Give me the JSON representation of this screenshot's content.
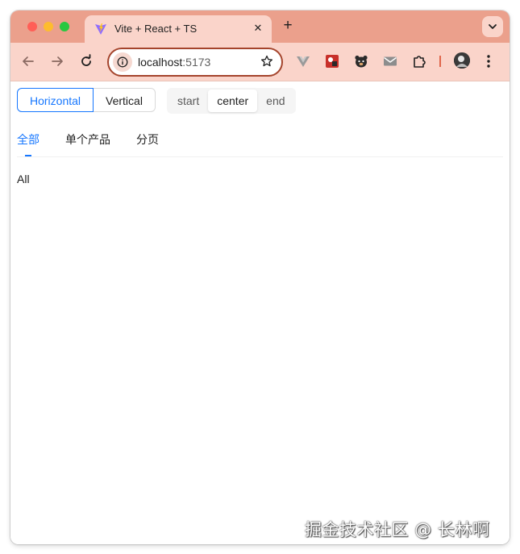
{
  "browser": {
    "tab": {
      "title": "Vite + React + TS",
      "close_glyph": "✕"
    },
    "new_tab_glyph": "+",
    "address": {
      "host": "localhost",
      "port": ":5173"
    },
    "icons": {
      "back": "arrow-left-icon",
      "forward": "arrow-right-icon",
      "reload": "reload-icon",
      "site_info": "info-icon",
      "bookmark": "star-icon",
      "tab_search": "chevron-down-icon",
      "extensions": [
        "vue-devtools-icon",
        "red-extension-icon",
        "bear-extension-icon",
        "mail-icon",
        "puzzle-icon"
      ],
      "profile": "avatar-icon",
      "menu": "kebab-menu-icon"
    },
    "colors": {
      "tabstrip": "#eba08c",
      "toolbar": "#fad4ca",
      "omnibox_border": "#a4442c"
    }
  },
  "layout_switch": {
    "options": [
      "Horizontal",
      "Vertical"
    ],
    "selected": "Horizontal"
  },
  "align_switch": {
    "options": [
      "start",
      "center",
      "end"
    ],
    "selected": "center"
  },
  "tabs": {
    "items": [
      "全部",
      "单个产品",
      "分页"
    ],
    "active_index": 0,
    "panel_content": "All"
  },
  "accent_color": "#1677ff",
  "watermark": "掘金技术社区 @ 长林啊"
}
